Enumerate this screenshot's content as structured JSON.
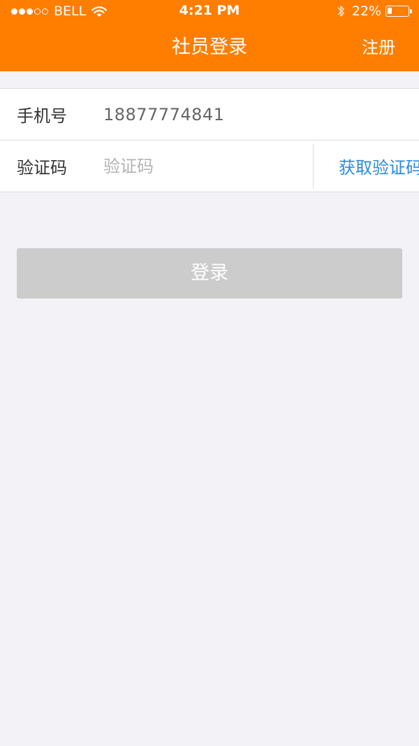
{
  "status_bar": {
    "carrier": "BELL",
    "time": "4:21 PM",
    "battery_percent_text": "22%",
    "battery_level": 0.22,
    "signal_bars_filled": 3,
    "signal_bars_total": 5
  },
  "nav": {
    "title": "社员登录",
    "register_label": "注册"
  },
  "form": {
    "phone_label": "手机号",
    "phone_value": "18877774841",
    "code_label": "验证码",
    "code_placeholder": "验证码",
    "get_code_label": "获取验证码"
  },
  "login_label": "登录",
  "colors": {
    "header_bg": "#ff7e00",
    "page_bg": "#f3f3f7",
    "link_blue": "#2a8be0",
    "button_disabled": "#cccccc"
  },
  "icons": {
    "wifi": "wifi-icon",
    "bluetooth": "bluetooth-icon",
    "battery": "battery-icon"
  }
}
